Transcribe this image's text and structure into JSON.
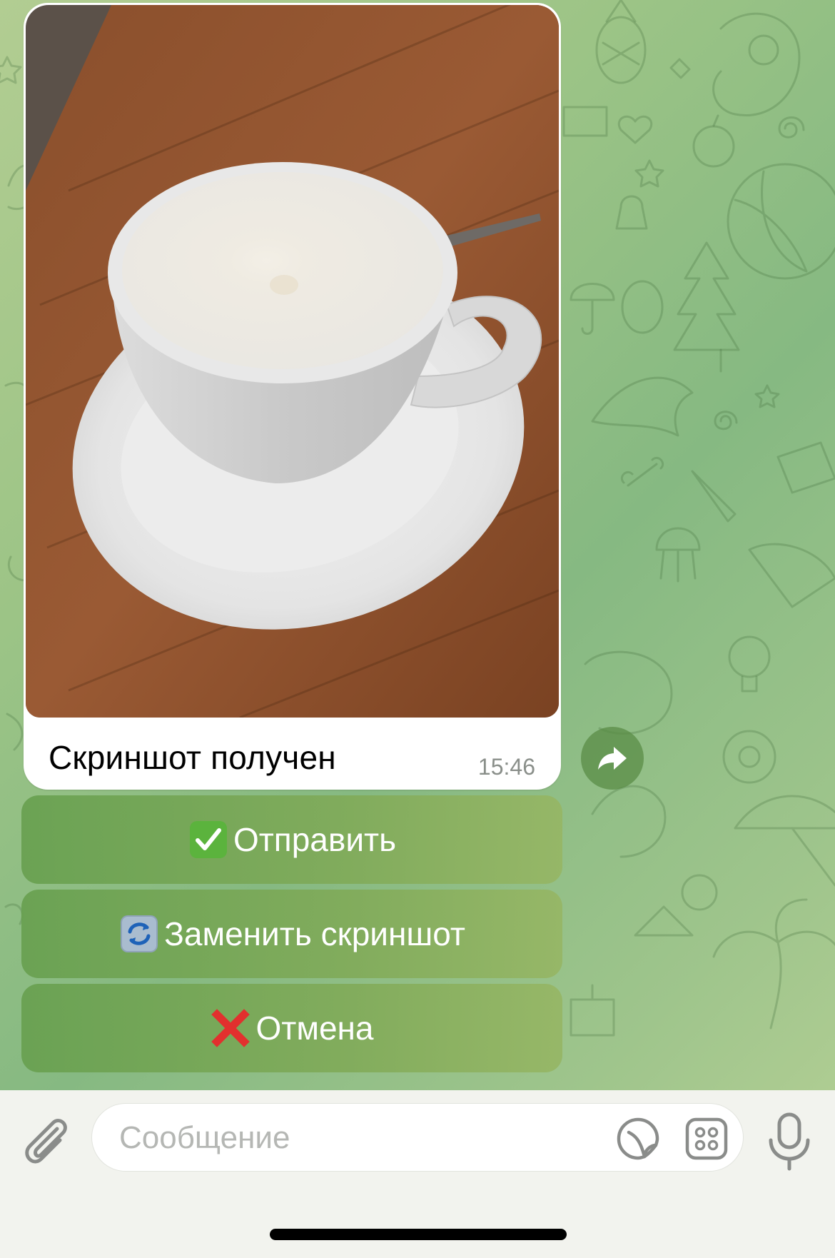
{
  "message": {
    "caption": "Скриншот получен",
    "time": "15:46",
    "photo_icon": "coffee-cup-photo"
  },
  "keyboard": {
    "send": {
      "emoji": "check-mark-button-icon",
      "label": "Отправить"
    },
    "replace": {
      "emoji": "refresh-arrows-icon",
      "label": "Заменить скриншот"
    },
    "cancel": {
      "emoji": "cross-mark-icon",
      "label": "Отмена"
    }
  },
  "input": {
    "placeholder": "Сообщение"
  },
  "colors": {
    "accent_green": "#6aa352",
    "check_green": "#56b33b",
    "cross_red": "#e0312f"
  }
}
